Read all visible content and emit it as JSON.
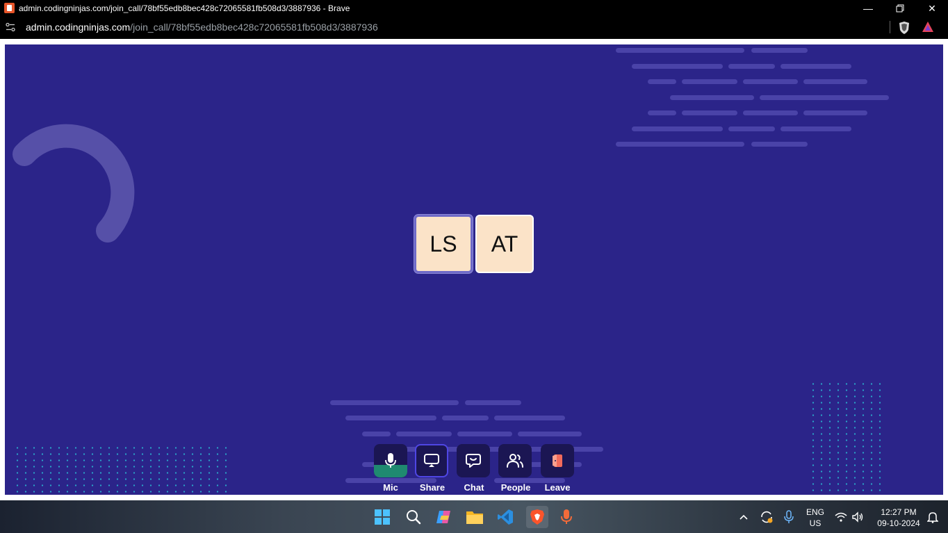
{
  "window": {
    "title": "admin.codingninjas.com/join_call/78bf55edb8bec428c72065581fb508d3/3887936 - Brave"
  },
  "addressbar": {
    "host": "admin.codingninjas.com",
    "path": "/join_call/78bf55edb8bec428c72065581fb508d3/3887936"
  },
  "participants": [
    {
      "initials": "LS"
    },
    {
      "initials": "AT"
    }
  ],
  "controls": {
    "mic": "Mic",
    "share": "Share",
    "chat": "Chat",
    "people": "People",
    "leave": "Leave"
  },
  "taskbar": {
    "language": "ENG",
    "region": "US",
    "time": "12:27 PM",
    "date": "09-10-2024"
  },
  "colors": {
    "stage_bg": "#2b2489",
    "mic_active": "#1f8a70",
    "share_border": "#4f46e5",
    "leave_icon": "#f26b5b",
    "tile_bg": "#fbe3c8"
  }
}
